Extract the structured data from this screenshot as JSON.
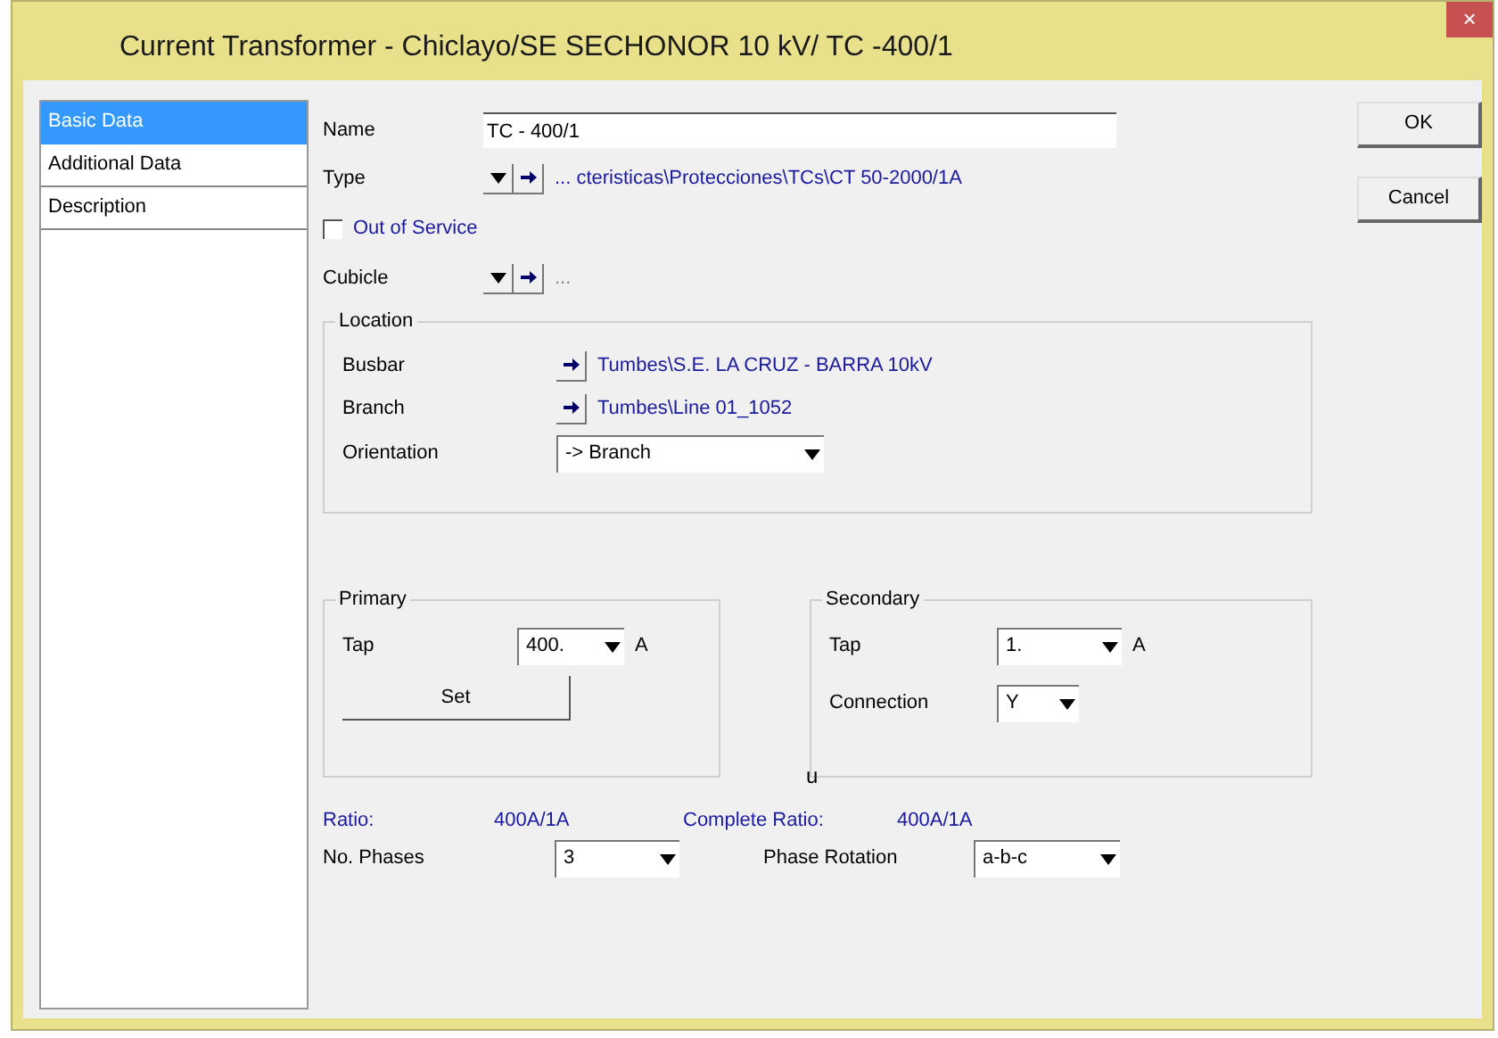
{
  "window": {
    "title": "Current Transformer - Chiclayo/SE SECHONOR 10 kV/ TC -400/1",
    "close": "×"
  },
  "sidebar": {
    "items": [
      {
        "label": "Basic Data",
        "selected": true
      },
      {
        "label": "Additional Data",
        "selected": false
      },
      {
        "label": "Description",
        "selected": false
      }
    ]
  },
  "name": {
    "label": "Name",
    "value": "TC - 400/1"
  },
  "type": {
    "label": "Type",
    "path": "... cteristicas\\Protecciones\\TCs\\CT 50-2000/1A"
  },
  "out_of_service": {
    "label": "Out of Service",
    "checked": false
  },
  "cubicle": {
    "label": "Cubicle",
    "path": "..."
  },
  "location": {
    "title": "Location",
    "busbar": {
      "label": "Busbar",
      "path": "Tumbes\\S.E. LA CRUZ - BARRA 10kV"
    },
    "branch": {
      "label": "Branch",
      "path": "Tumbes\\Line 01_1052"
    },
    "orientation": {
      "label": "Orientation",
      "value": "-> Branch"
    }
  },
  "primary": {
    "title": "Primary",
    "tap": {
      "label": "Tap",
      "value": "400.",
      "unit": "A"
    },
    "set_button": "Set"
  },
  "secondary": {
    "title": "Secondary",
    "tap": {
      "label": "Tap",
      "value": "1.",
      "unit": "A"
    },
    "connection": {
      "label": "Connection",
      "value": "Y"
    }
  },
  "stray_mark": "u",
  "ratio": {
    "label": "Ratio:",
    "value": "400A/1A"
  },
  "complete_ratio": {
    "label": "Complete Ratio:",
    "value": "400A/1A"
  },
  "phases": {
    "label": "No. Phases",
    "value": "3"
  },
  "phase_rotation": {
    "label": "Phase Rotation",
    "value": "a-b-c"
  },
  "buttons": [
    "OK",
    "Cancel"
  ]
}
